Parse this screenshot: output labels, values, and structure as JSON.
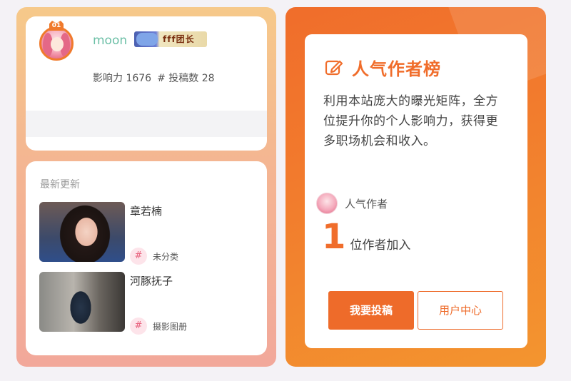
{
  "profile": {
    "rank_badge": "01",
    "username": "moon",
    "vip_badge_text": "fff团长",
    "influence_label": "影响力",
    "influence_value": "1676",
    "posts_label": "# 投稿数",
    "posts_value": "28"
  },
  "updates": {
    "title": "最新更新",
    "items": [
      {
        "title": "章若楠",
        "category": "未分类"
      },
      {
        "title": "河豚抚子",
        "category": "摄影图册"
      }
    ]
  },
  "ranking": {
    "title": "人气作者榜",
    "description": "利用本站庞大的曝光矩阵，全方位提升你的个人影响力，获得更多职场机会和收入。",
    "author_label": "人气作者",
    "count": "1",
    "count_label": "位作者加入",
    "submit_button": "我要投稿",
    "user_center_button": "用户中心"
  },
  "colors": {
    "accent": "#f06d2b",
    "username": "#6bbfa6",
    "hash_bg": "#fde4ea"
  }
}
